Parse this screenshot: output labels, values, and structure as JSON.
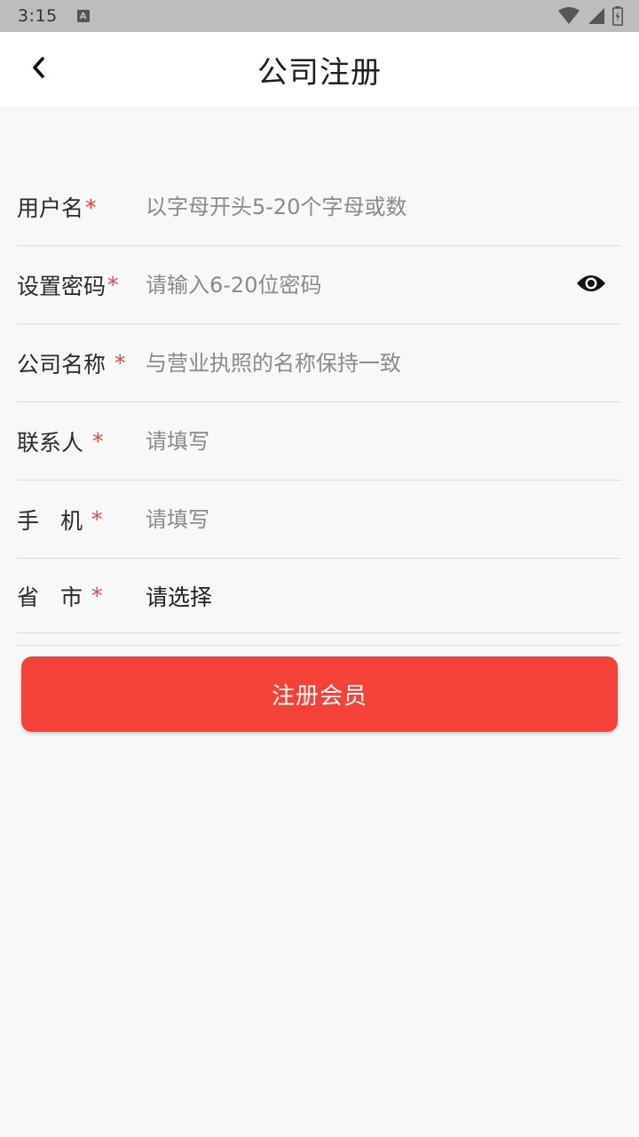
{
  "status_bar": {
    "time": "3:15",
    "notification_icon": "accessibility-a-icon",
    "icons": [
      "wifi-icon",
      "signal-icon",
      "battery-charging-icon"
    ]
  },
  "header": {
    "title": "公司注册",
    "back_icon": "chevron-left-icon"
  },
  "form": {
    "username": {
      "label": "用户名",
      "star": "*",
      "placeholder": "以字母开头5-20个字母或数"
    },
    "password": {
      "label": "设置密码",
      "star": "*",
      "placeholder": "请输入6-20位密码",
      "toggle_icon": "eye-icon"
    },
    "company": {
      "label": "公司名称",
      "star": "*",
      "placeholder": "与营业执照的名称保持一致"
    },
    "contact": {
      "label": "联系人",
      "star": "*",
      "placeholder": "请填写"
    },
    "phone": {
      "label": "手 机",
      "star": "*",
      "placeholder": "请填写"
    },
    "region": {
      "label": "省 市",
      "star": "*",
      "value": "请选择"
    }
  },
  "submit": {
    "label": "注册会员"
  },
  "colors": {
    "accent": "#f44336",
    "required": "#e8453c",
    "background": "#f8f8f8",
    "status_bar": "#bdbdbd"
  }
}
